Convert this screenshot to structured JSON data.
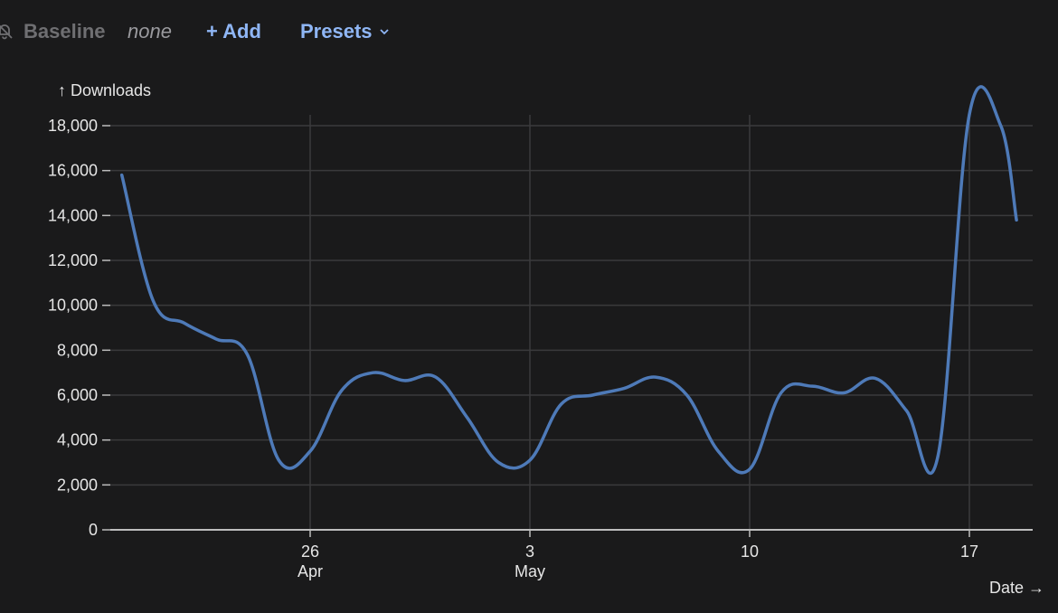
{
  "toolbar": {
    "baseline_label": "Baseline",
    "baseline_value": "none",
    "add_label": "+ Add",
    "presets_label": "Presets",
    "icon_baseline": "bell-slash-icon",
    "icon_presets": "chevron-down-icon"
  },
  "colors": {
    "background": "#1a1a1b",
    "line": "#4e7ab8",
    "grid": "#3a3a3c",
    "accent": "#8fb6f5"
  },
  "chart_data": {
    "type": "line",
    "title": "",
    "xlabel": "Date →",
    "ylabel": "↑ Downloads",
    "ylim": [
      0,
      18000
    ],
    "y_ticks": [
      0,
      2000,
      4000,
      6000,
      8000,
      10000,
      12000,
      14000,
      16000,
      18000
    ],
    "y_tick_labels": [
      "0",
      "2,000",
      "4,000",
      "6,000",
      "8,000",
      "10,000",
      "12,000",
      "14,000",
      "16,000",
      "18,000"
    ],
    "x_ticks": [
      {
        "date": "2025-04-26",
        "label": "26",
        "sublabel": "Apr"
      },
      {
        "date": "2025-05-03",
        "label": "3",
        "sublabel": "May"
      },
      {
        "date": "2025-05-10",
        "label": "10",
        "sublabel": ""
      },
      {
        "date": "2025-05-17",
        "label": "17",
        "sublabel": ""
      }
    ],
    "xlim": [
      "2025-04-20",
      "2025-05-18"
    ],
    "grid": true,
    "series": [
      {
        "points": [
          {
            "x": "2025-04-20",
            "y": 15800
          },
          {
            "x": "2025-04-21",
            "y": 10200
          },
          {
            "x": "2025-04-22",
            "y": 9200
          },
          {
            "x": "2025-04-23",
            "y": 8500
          },
          {
            "x": "2025-04-24",
            "y": 7800
          },
          {
            "x": "2025-04-25",
            "y": 3100
          },
          {
            "x": "2025-04-26",
            "y": 3500
          },
          {
            "x": "2025-04-27",
            "y": 6200
          },
          {
            "x": "2025-04-28",
            "y": 7000
          },
          {
            "x": "2025-04-29",
            "y": 6650
          },
          {
            "x": "2025-04-30",
            "y": 6800
          },
          {
            "x": "2025-05-01",
            "y": 5000
          },
          {
            "x": "2025-05-02",
            "y": 3000
          },
          {
            "x": "2025-05-03",
            "y": 3100
          },
          {
            "x": "2025-05-04",
            "y": 5600
          },
          {
            "x": "2025-05-05",
            "y": 6000
          },
          {
            "x": "2025-05-06",
            "y": 6300
          },
          {
            "x": "2025-05-07",
            "y": 6800
          },
          {
            "x": "2025-05-08",
            "y": 6000
          },
          {
            "x": "2025-05-09",
            "y": 3500
          },
          {
            "x": "2025-05-10",
            "y": 2700
          },
          {
            "x": "2025-05-11",
            "y": 6100
          },
          {
            "x": "2025-05-12",
            "y": 6400
          },
          {
            "x": "2025-05-13",
            "y": 6100
          },
          {
            "x": "2025-05-14",
            "y": 6750
          },
          {
            "x": "2025-05-15",
            "y": 5300
          },
          {
            "x": "2025-05-16",
            "y": 3300
          },
          {
            "x": "2025-05-17",
            "y": 18500
          },
          {
            "x": "2025-05-18",
            "y": 18000
          },
          {
            "x": "2025-05-18T12:00",
            "y": 13800
          }
        ]
      }
    ]
  }
}
